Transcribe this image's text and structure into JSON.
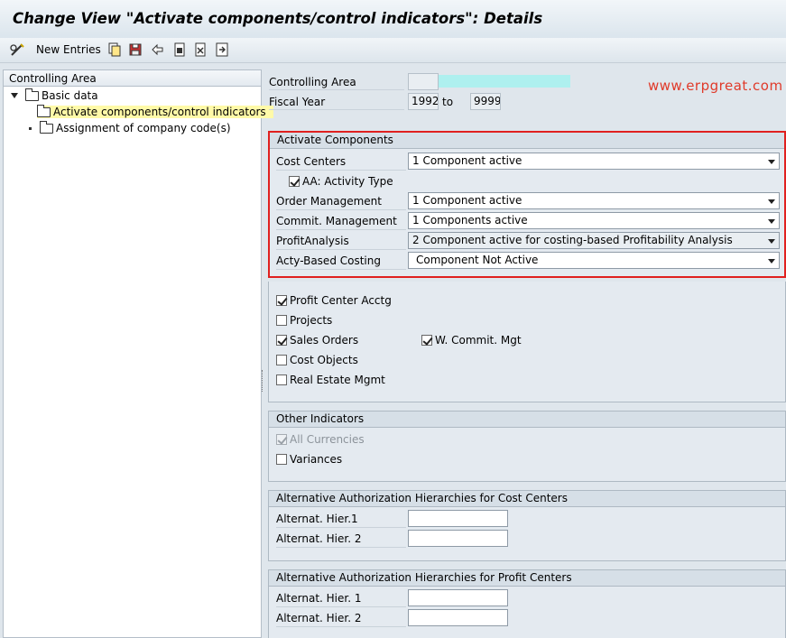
{
  "window": {
    "title": "Change View \"Activate components/control indicators\": Details"
  },
  "toolbar": {
    "new_entries_label": "New Entries",
    "icons": [
      "glasses-pencil-icon",
      "copy-icon",
      "save-as-icon",
      "undo-icon",
      "select-all-icon",
      "deselect-icon",
      "navigate-icon"
    ]
  },
  "tree": {
    "header": "Controlling Area",
    "root_label": "Basic data",
    "items": [
      {
        "label": "Activate components/control indicators",
        "selected": true
      },
      {
        "label": "Assignment of company code(s)",
        "selected": false
      }
    ]
  },
  "header_fields": {
    "controlling_area_label": "Controlling Area",
    "fiscal_year_label": "Fiscal Year",
    "fiscal_year_from": "1992",
    "to_label": "to",
    "fiscal_year_to": "9999"
  },
  "watermark": "www.erpgreat.com",
  "activate_components": {
    "title": "Activate Components",
    "cost_centers_label": "Cost Centers",
    "cost_centers_value": "1 Component active",
    "activity_type_label": "AA: Activity Type",
    "activity_type_checked": true,
    "order_mgmt_label": "Order Management",
    "order_mgmt_value": "1 Component active",
    "commit_mgmt_label": "Commit. Management",
    "commit_mgmt_value": "1 Components active",
    "profit_analysis_label": "ProfitAnalysis",
    "profit_analysis_value": "2 Component active for costing-based Profitability Analysis",
    "acty_based_label": "Acty-Based Costing",
    "acty_based_value": "Component Not Active"
  },
  "checkboxes": {
    "profit_center": {
      "label": "Profit Center Acctg",
      "checked": true
    },
    "projects": {
      "label": "Projects",
      "checked": false
    },
    "sales_orders": {
      "label": "Sales Orders",
      "checked": true
    },
    "w_commit": {
      "label": "W. Commit. Mgt",
      "checked": true
    },
    "cost_objects": {
      "label": "Cost Objects",
      "checked": false
    },
    "real_estate": {
      "label": "Real Estate Mgmt",
      "checked": false
    }
  },
  "other_indicators": {
    "title": "Other Indicators",
    "all_currencies": {
      "label": "All Currencies",
      "checked": true,
      "disabled": true
    },
    "variances": {
      "label": "Variances",
      "checked": false
    }
  },
  "auth_cost_centers": {
    "title": "Alternative Authorization Hierarchies for Cost Centers",
    "hier1_label": "Alternat. Hier.1",
    "hier1_value": "",
    "hier2_label": "Alternat. Hier. 2",
    "hier2_value": ""
  },
  "auth_profit_centers": {
    "title": "Alternative Authorization Hierarchies for Profit Centers",
    "hier1_label": "Alternat. Hier. 1",
    "hier1_value": "",
    "hier2_label": "Alternat. Hier. 2",
    "hier2_value": ""
  }
}
